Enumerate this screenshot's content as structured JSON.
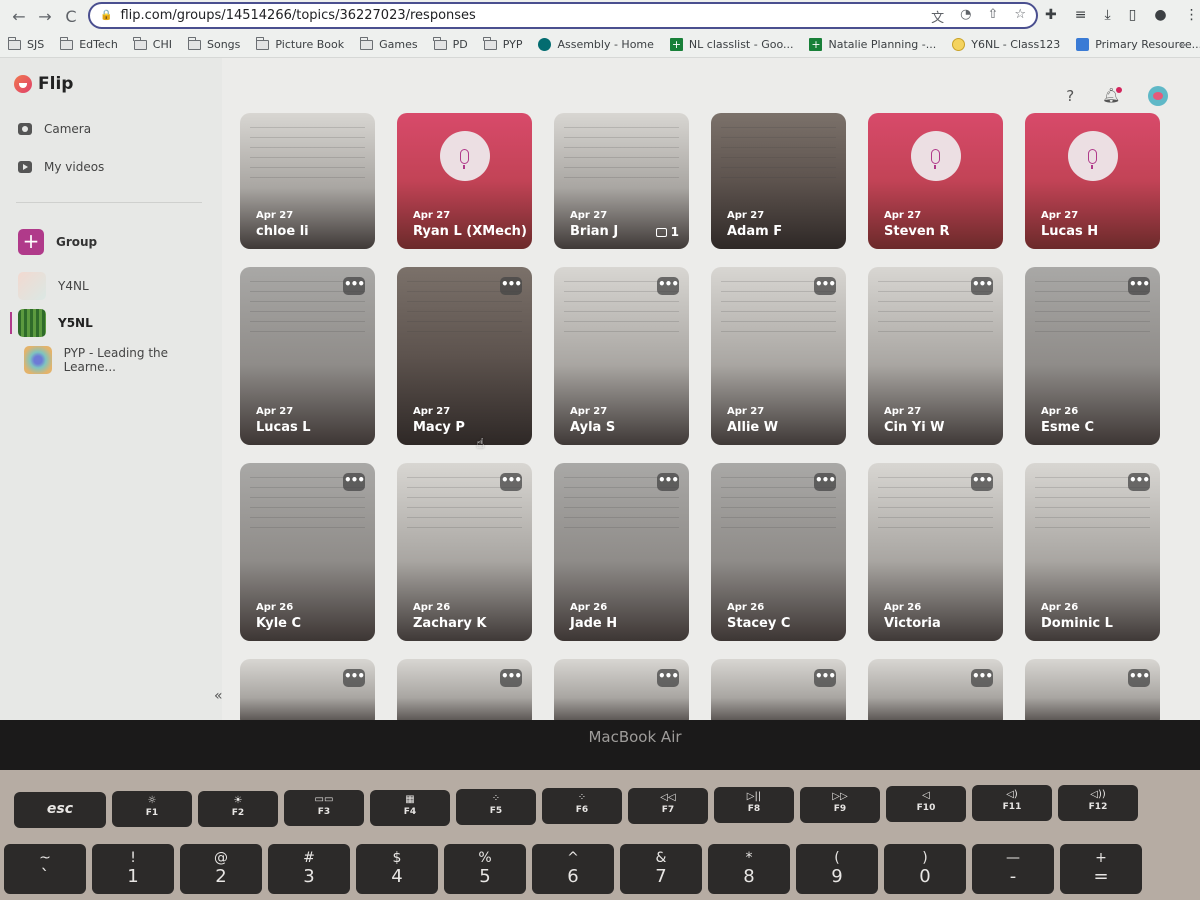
{
  "browser": {
    "url": "flip.com/groups/14514266/topics/36227023/responses",
    "nav": {
      "back": "←",
      "forward": "→",
      "reload": "C"
    },
    "omnibox_icons": [
      "translate-icon",
      "performance-icon",
      "share-icon",
      "bookmark-star-icon"
    ],
    "toolbar_icons": [
      "extensions-icon",
      "media-icon",
      "download-icon",
      "side-panel-icon",
      "profile-icon",
      "menu-icon"
    ],
    "bookmarks": [
      {
        "label": "SJS",
        "icon": "folder"
      },
      {
        "label": "EdTech",
        "icon": "folder"
      },
      {
        "label": "CHI",
        "icon": "folder"
      },
      {
        "label": "Songs",
        "icon": "folder"
      },
      {
        "label": "Picture Book",
        "icon": "folder"
      },
      {
        "label": "Games",
        "icon": "folder"
      },
      {
        "label": "PD",
        "icon": "folder"
      },
      {
        "label": "PYP",
        "icon": "folder"
      },
      {
        "label": "Assembly - Home",
        "icon": "sharepoint"
      },
      {
        "label": "NL classlist - Goo...",
        "icon": "sheets"
      },
      {
        "label": "Natalie Planning -...",
        "icon": "sheets"
      },
      {
        "label": "Y6NL - Class123",
        "icon": "class123"
      },
      {
        "label": "Primary Resource...",
        "icon": "primary-resources"
      }
    ],
    "bookmarks_overflow": "»"
  },
  "app": {
    "name": "Flip",
    "sidebar": {
      "camera": "Camera",
      "my_videos": "My videos",
      "add_group": "Group",
      "groups": [
        {
          "label": "Y4NL",
          "active": false
        },
        {
          "label": "Y5NL",
          "active": true
        },
        {
          "label": "PYP - Leading the Learne...",
          "active": false
        }
      ],
      "collapse": "«"
    },
    "topbar": {
      "help": "?",
      "notifications_unread": true
    },
    "accent_color": "#b03a8a",
    "responses": [
      {
        "date": "Apr 27",
        "name": "chloe li",
        "type": "video"
      },
      {
        "date": "Apr 27",
        "name": "Ryan L (XMech)",
        "type": "audio"
      },
      {
        "date": "Apr 27",
        "name": "Brian J",
        "type": "video",
        "comments": "1"
      },
      {
        "date": "Apr 27",
        "name": "Adam F",
        "type": "video"
      },
      {
        "date": "Apr 27",
        "name": "Steven R",
        "type": "audio"
      },
      {
        "date": "Apr 27",
        "name": "Lucas H",
        "type": "audio"
      },
      {
        "date": "Apr 27",
        "name": "Lucas L",
        "type": "video"
      },
      {
        "date": "Apr 27",
        "name": "Macy P",
        "type": "video"
      },
      {
        "date": "Apr 27",
        "name": "Ayla S",
        "type": "video"
      },
      {
        "date": "Apr 27",
        "name": "Allie W",
        "type": "video"
      },
      {
        "date": "Apr 27",
        "name": "Cin Yi W",
        "type": "video"
      },
      {
        "date": "Apr 26",
        "name": "Esme C",
        "type": "video"
      },
      {
        "date": "Apr 26",
        "name": "Kyle C",
        "type": "video"
      },
      {
        "date": "Apr 26",
        "name": "Zachary K",
        "type": "video"
      },
      {
        "date": "Apr 26",
        "name": "Jade H",
        "type": "video"
      },
      {
        "date": "Apr 26",
        "name": "Stacey C",
        "type": "video"
      },
      {
        "date": "Apr 26",
        "name": "Victoria",
        "type": "video"
      },
      {
        "date": "Apr 26",
        "name": "Dominic L",
        "type": "video"
      }
    ],
    "more_label": "•••"
  },
  "laptop": {
    "brand": "MacBook Air",
    "function_keys": [
      "esc",
      "F1",
      "F2",
      "F3",
      "F4",
      "F5",
      "F6",
      "F7",
      "F8",
      "F9",
      "F10",
      "F11",
      "F12"
    ],
    "function_key_icons": [
      "",
      "☼",
      "☀",
      "▭▭",
      "▦",
      "⁘",
      "⁘",
      "◁◁",
      "▷||",
      "▷▷",
      "◁",
      "◁)",
      "◁))"
    ],
    "number_keys": [
      {
        "top": "~",
        "bottom": "`"
      },
      {
        "top": "!",
        "bottom": "1"
      },
      {
        "top": "@",
        "bottom": "2"
      },
      {
        "top": "#",
        "bottom": "3"
      },
      {
        "top": "$",
        "bottom": "4"
      },
      {
        "top": "%",
        "bottom": "5"
      },
      {
        "top": "^",
        "bottom": "6"
      },
      {
        "top": "&",
        "bottom": "7"
      },
      {
        "top": "*",
        "bottom": "8"
      },
      {
        "top": "(",
        "bottom": "9"
      },
      {
        "top": ")",
        "bottom": "0"
      },
      {
        "top": "—",
        "bottom": "-"
      },
      {
        "top": "+",
        "bottom": "="
      }
    ]
  }
}
